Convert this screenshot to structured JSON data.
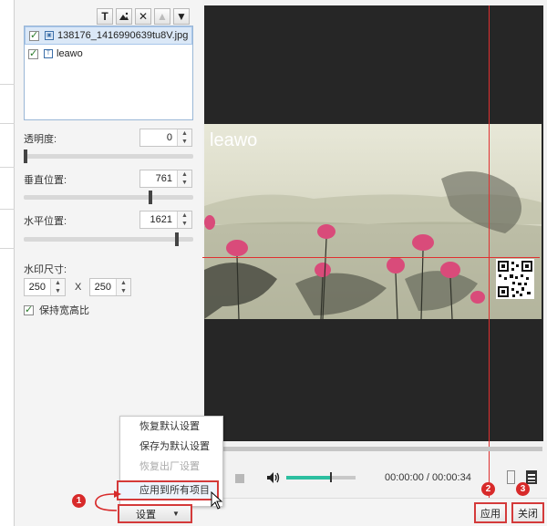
{
  "toolbar": {
    "buttons": [
      {
        "name": "add-text-watermark",
        "glyph": "T"
      },
      {
        "name": "add-image-watermark",
        "glyph": "▲"
      },
      {
        "name": "delete-watermark",
        "glyph": "✕"
      },
      {
        "name": "move-up",
        "glyph": "▲"
      },
      {
        "name": "move-down",
        "glyph": "▼"
      }
    ]
  },
  "watermark_list": {
    "items": [
      {
        "label": "138176_1416990639tu8V.jpg",
        "type_icon": "image-file-icon",
        "checked": true,
        "selected": true
      },
      {
        "label": "leawo",
        "type_icon": "text-watermark-icon",
        "checked": true,
        "selected": false
      }
    ]
  },
  "properties": {
    "transparency_label": "透明度:",
    "transparency_value": "0",
    "vertical_label": "垂直位置:",
    "vertical_value": "761",
    "horizontal_label": "水平位置:",
    "horizontal_value": "1621",
    "size_label": "水印尺寸:",
    "width_value": "250",
    "height_value": "250",
    "size_separator": "X",
    "keep_ratio_label": "保持宽高比",
    "keep_ratio_checked": true
  },
  "context_menu": {
    "items": [
      {
        "label": "恢复默认设置",
        "disabled": false
      },
      {
        "label": "保存为默认设置",
        "disabled": false
      },
      {
        "label": "恢复出厂设置",
        "disabled": true
      },
      {
        "label": "应用到所有项目",
        "disabled": false,
        "highlighted": true
      }
    ]
  },
  "settings_button": {
    "label": "设置"
  },
  "preview": {
    "watermark_text": "leawo",
    "time_current": "00:00:00",
    "time_total": "00:00:34",
    "time_separator": "/",
    "volume_level": 0.65
  },
  "footer": {
    "apply_label": "应用",
    "close_label": "关闭"
  },
  "annotations": {
    "badge_1": "1",
    "badge_2": "2",
    "badge_3": "3",
    "color": "#d82a2a"
  }
}
